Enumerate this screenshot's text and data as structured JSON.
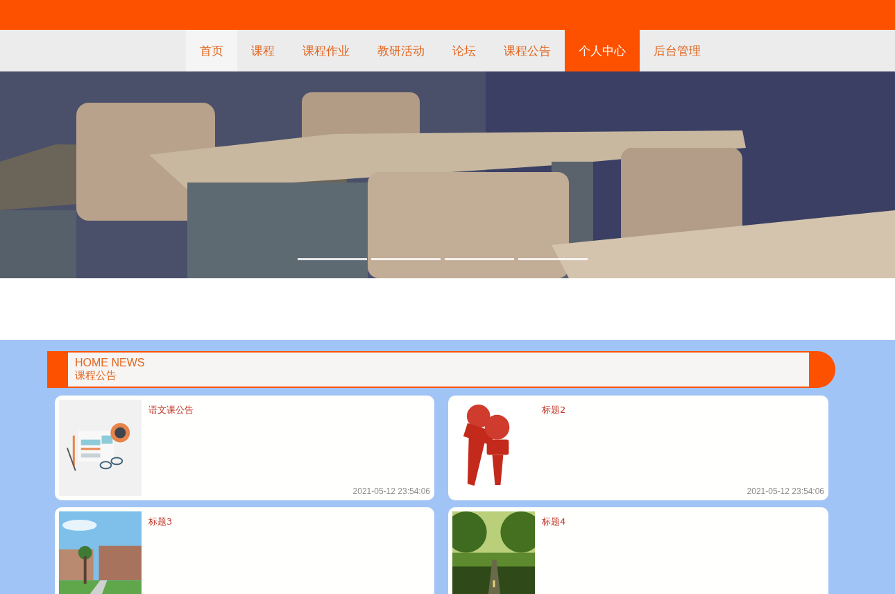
{
  "nav": {
    "items": [
      {
        "label": "首页",
        "selected": false
      },
      {
        "label": "课程",
        "selected": false
      },
      {
        "label": "课程作业",
        "selected": false
      },
      {
        "label": "教研活动",
        "selected": false
      },
      {
        "label": "论坛",
        "selected": false
      },
      {
        "label": "课程公告",
        "selected": false
      },
      {
        "label": "个人中心",
        "selected": true
      },
      {
        "label": "后台管理",
        "selected": false
      }
    ]
  },
  "banner": {
    "kind": "picture",
    "indicators": [
      {
        "selected": false
      },
      {
        "selected": false
      },
      {
        "selected": false
      },
      {
        "selected": false
      }
    ]
  },
  "news": {
    "title_en": "HOME NEWS",
    "title": "课程公告",
    "cards": [
      {
        "title": "语文课公告",
        "time": "2021-05-12 23:54:06"
      },
      {
        "title": "标题2",
        "time": "2021-05-12 23:54:06"
      },
      {
        "title": "标题3"
      },
      {
        "title": "标题4"
      }
    ]
  }
}
